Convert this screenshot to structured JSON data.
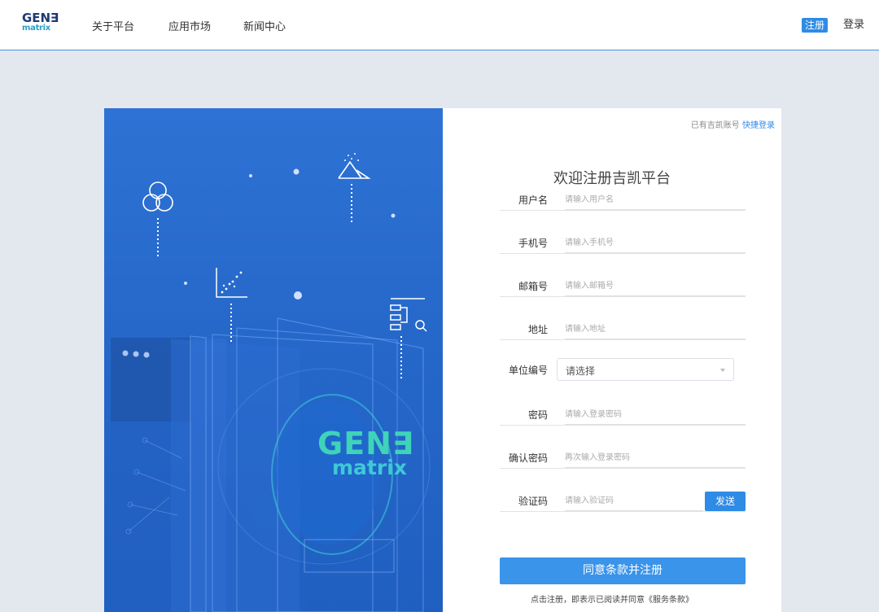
{
  "header": {
    "logo_top": "GEN∃",
    "logo_bottom": "matrix",
    "nav": [
      {
        "label": "关于平台"
      },
      {
        "label": "应用市场"
      },
      {
        "label": "新闻中心"
      }
    ],
    "register_label": "注册",
    "login_label": "登录"
  },
  "illustration": {
    "brand_top": "GEN∃",
    "brand_bottom": "matrix"
  },
  "form": {
    "have_account_text": "已有吉凯账号",
    "quick_login_link": "快捷登录",
    "title": "欢迎注册吉凯平台",
    "fields": [
      {
        "label": "用户名",
        "placeholder": "请输入用户名"
      },
      {
        "label": "手机号",
        "placeholder": "请输入手机号"
      },
      {
        "label": "邮箱号",
        "placeholder": "请输入邮箱号"
      },
      {
        "label": "地址",
        "placeholder": "请输入地址"
      }
    ],
    "unit": {
      "label": "单位编号",
      "value": "请选择"
    },
    "password": {
      "label": "密码",
      "placeholder": "请输入登录密码"
    },
    "confirm_password": {
      "label": "确认密码",
      "placeholder": "再次输入登录密码"
    },
    "captcha": {
      "label": "验证码",
      "placeholder": "请输入验证码",
      "send_label": "发送"
    },
    "submit_label": "同意条款并注册",
    "terms_text": "点击注册，即表示已阅读并同意《服务条款》"
  },
  "colors": {
    "accent": "#2e8be6",
    "illustration_bg": "#2567c9",
    "page_bg": "#e3e8ef"
  }
}
